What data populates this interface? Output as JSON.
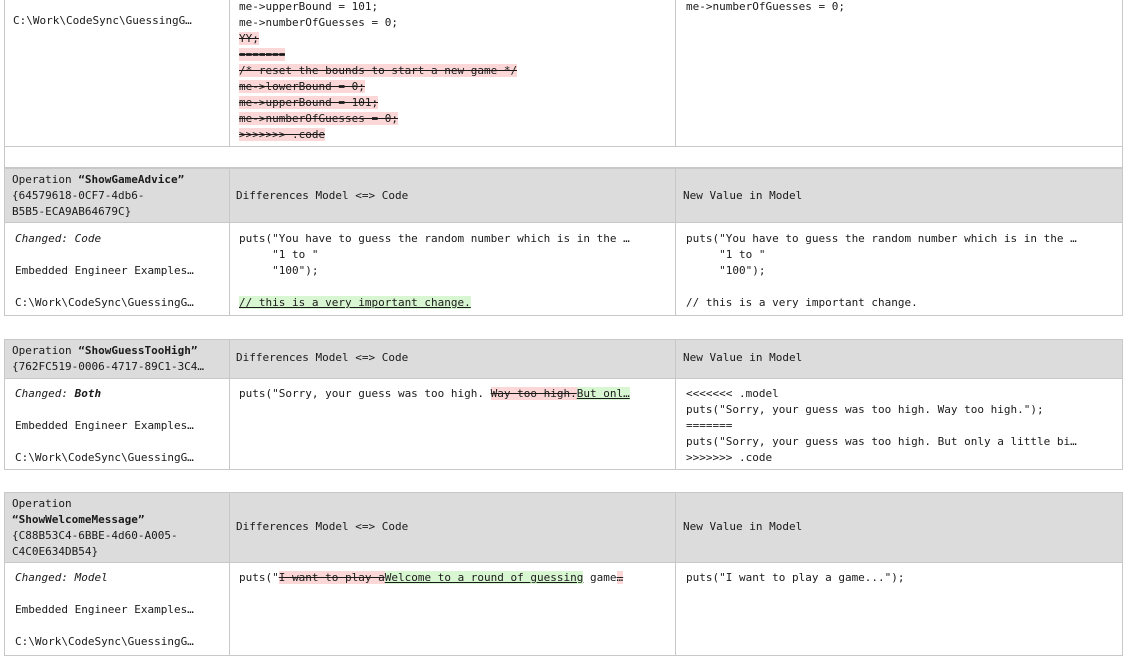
{
  "headers": {
    "diff": "Differences Model <=> Code",
    "newval": "New Value in Model"
  },
  "top_block": {
    "path": "C:\\Work\\CodeSync\\GuessingG…",
    "diff_lines": [
      "me->upperBound = 101;",
      "me->numberOfGuesses = 0;",
      "YY;",
      "=======",
      "/* reset the bounds to start a new game */",
      "me->lowerBound = 0;",
      "me->upperBound = 101;",
      "me->numberOfGuesses = 0;",
      ">>>>>>> .code"
    ],
    "new_lines": [
      "me->numberOfGuesses = 0;"
    ]
  },
  "op1": {
    "title_prefix": "Operation ",
    "name": "“ShowGameAdvice”",
    "guid1": "{64579618-0CF7-4db6-",
    "guid2": "B5B5-ECA9AB64679C}",
    "changed_label": "Changed: ",
    "changed_value": "Code",
    "package": "Embedded Engineer Examples…",
    "path": "C:\\Work\\CodeSync\\GuessingG…",
    "diff_lines": [
      "puts(\"You have to guess the random number which is in the …",
      "     \"1 to \"",
      "     \"100\");"
    ],
    "diff_inserted": "// this is a very important change.",
    "new_lines": [
      "puts(\"You have to guess the random number which is in the …",
      "     \"1 to \"",
      "     \"100\");",
      "",
      "// this is a very important change."
    ]
  },
  "op2": {
    "title_prefix": "Operation ",
    "name": "“ShowGuessTooHigh”",
    "guid1": "{762FC519-0006-4717-89C1-3C4…",
    "changed_label": "Changed: ",
    "changed_value": "Both",
    "package": "Embedded Engineer Examples…",
    "path": "C:\\Work\\CodeSync\\GuessingG…",
    "diff_plain": "puts(\"Sorry, your guess was too high. ",
    "diff_deleted": "Way too high.",
    "diff_inserted": "But onl…",
    "new_lines": [
      "<<<<<<< .model",
      "puts(\"Sorry, your guess was too high. Way too high.\");",
      "=======",
      "puts(\"Sorry, your guess was too high. But only a little bi…",
      ">>>>>>> .code"
    ]
  },
  "op3": {
    "title_prefix": "Operation",
    "name": "“ShowWelcomeMessage”",
    "guid1": "{C88B53C4-6BBE-4d60-A005-",
    "guid2": "C4C0E634DB54}",
    "changed_label": "Changed: ",
    "changed_value": "Model",
    "package": "Embedded Engineer Examples…",
    "path": "C:\\Work\\CodeSync\\GuessingG…",
    "diff_plain": "puts(\"",
    "diff_deleted": "I want to play a",
    "diff_inserted": "Welcome to a round of guessing",
    "diff_plain2": " game",
    "diff_deleted2": "…",
    "new_lines": [
      "puts(\"I want to play a game...\");"
    ]
  }
}
